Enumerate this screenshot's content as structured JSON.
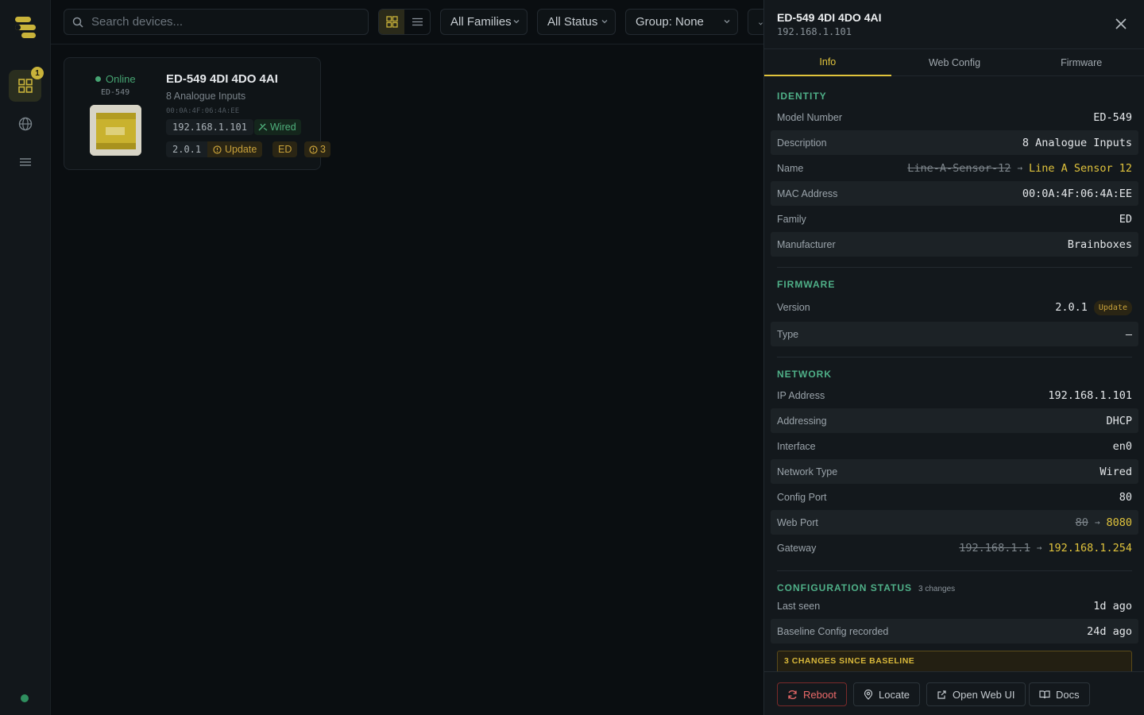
{
  "toolbar": {
    "search_placeholder": "Search devices...",
    "family_filter": "All Families",
    "status_filter": "All Status",
    "group_filter": "Group: None"
  },
  "rail": {
    "devices_badge": "1"
  },
  "device_card": {
    "status": "Online",
    "model": "ED-549",
    "title": "ED-549 4DI 4DO 4AI",
    "description": "8 Analogue Inputs",
    "mac": "00:0A:4F:06:4A:EE",
    "ip": "192.168.1.101",
    "network": "Wired",
    "version": "2.0.1",
    "update_label": "Update",
    "family": "ED",
    "warnings": "3"
  },
  "panel": {
    "title": "ED-549 4DI 4DO 4AI",
    "subtitle": "192.168.1.101",
    "tabs": [
      "Info",
      "Web Config",
      "Firmware"
    ],
    "identity": {
      "heading": "IDENTITY",
      "model_number_label": "Model Number",
      "model_number": "ED-549",
      "description_label": "Description",
      "description": "8 Analogue Inputs",
      "name_label": "Name",
      "name_old": "Line-A-Sensor-12",
      "name_new": "Line A Sensor 12",
      "mac_label": "MAC Address",
      "mac": "00:0A:4F:06:4A:EE",
      "family_label": "Family",
      "family": "ED",
      "manufacturer_label": "Manufacturer",
      "manufacturer": "Brainboxes"
    },
    "firmware": {
      "heading": "FIRMWARE",
      "version_label": "Version",
      "version": "2.0.1",
      "update_pill": "Update",
      "type_label": "Type",
      "type": "—"
    },
    "network": {
      "heading": "NETWORK",
      "ip_label": "IP Address",
      "ip": "192.168.1.101",
      "addressing_label": "Addressing",
      "addressing": "DHCP",
      "interface_label": "Interface",
      "interface": "en0",
      "network_type_label": "Network Type",
      "network_type": "Wired",
      "config_port_label": "Config Port",
      "config_port": "80",
      "web_port_label": "Web Port",
      "web_port_old": "80",
      "web_port_new": "8080",
      "gateway_label": "Gateway",
      "gateway_old": "192.168.1.1",
      "gateway_new": "192.168.1.254"
    },
    "config_status": {
      "heading": "CONFIGURATION STATUS",
      "count": "3 changes",
      "last_seen_label": "Last seen",
      "last_seen": "1d ago",
      "baseline_label": "Baseline Config recorded",
      "baseline": "24d ago",
      "changes_banner": "3 CHANGES SINCE BASELINE"
    },
    "footer": {
      "reboot": "Reboot",
      "locate": "Locate",
      "open_web_ui": "Open Web UI",
      "docs": "Docs"
    }
  },
  "colors": {
    "accent": "#e0c33c",
    "online": "#46a472",
    "section": "#4fb088",
    "danger": "#ec6a6a"
  }
}
